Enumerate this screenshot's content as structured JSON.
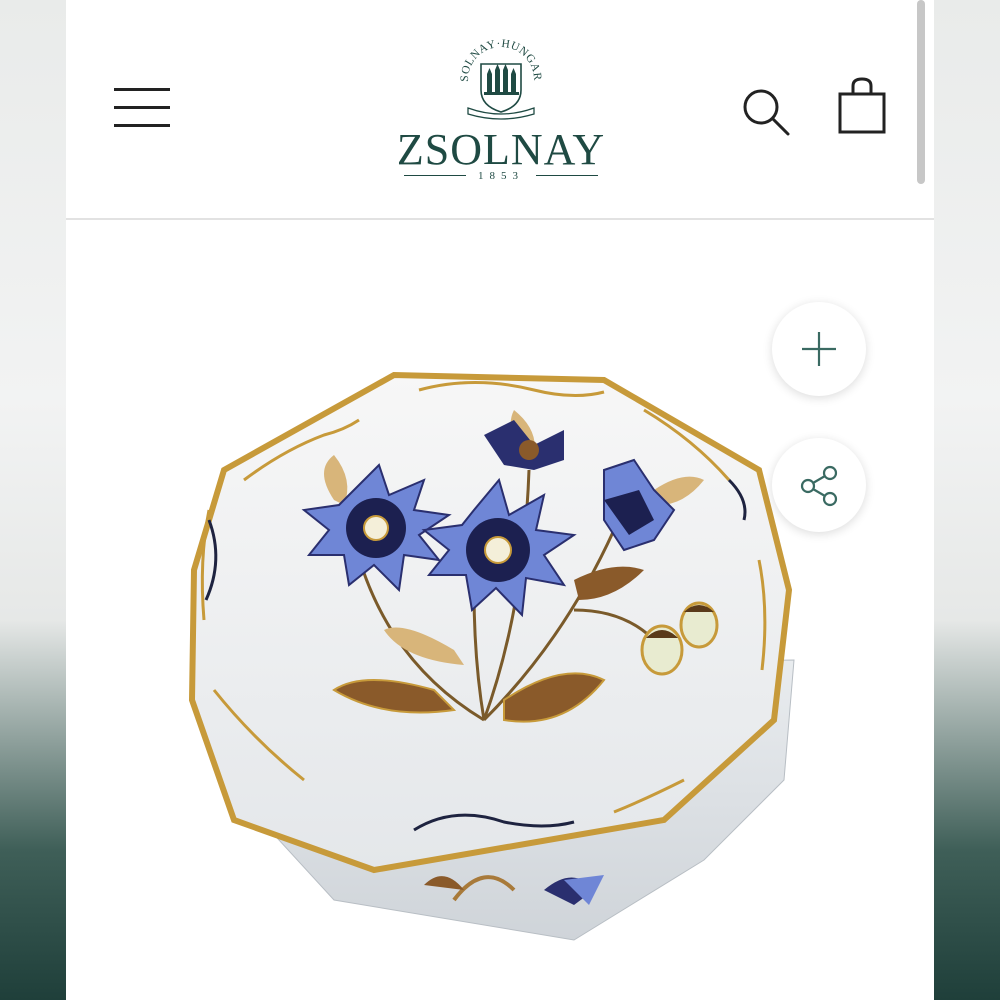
{
  "header": {
    "menu_icon": "hamburger-menu-icon",
    "search_icon": "search-icon",
    "cart_icon": "shopping-bag-icon"
  },
  "logo": {
    "seal_text": "ZSOLNAY·HUNGARY",
    "brand": "ZSOLNAY",
    "year": "1853",
    "color": "#1f4a43"
  },
  "product": {
    "image_alt": "octagonal porcelain box with blue cornflower decoration and gold trim",
    "actions": [
      {
        "icon": "plus-icon"
      },
      {
        "icon": "share-icon"
      }
    ]
  },
  "colors": {
    "brand_green": "#1f4a43",
    "cornflower_blue": "#6f86d6",
    "gold": "#c79a3a"
  }
}
